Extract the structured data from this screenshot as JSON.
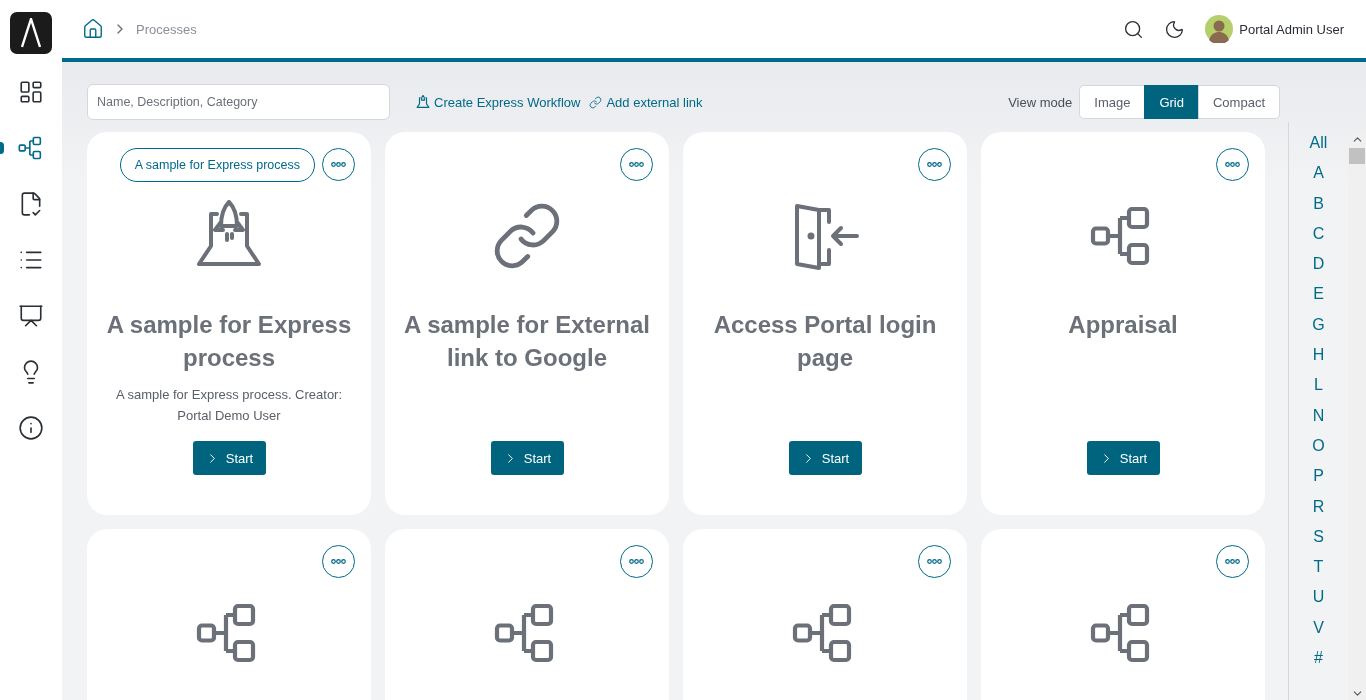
{
  "breadcrumb": {
    "current": "Processes"
  },
  "header": {
    "user": "Portal Admin User"
  },
  "sidebar": {
    "items": [
      {
        "kind": "dashboard",
        "selected": false
      },
      {
        "kind": "processes",
        "selected": true
      },
      {
        "kind": "tasks",
        "selected": false
      },
      {
        "kind": "cases",
        "selected": false
      },
      {
        "kind": "statistics",
        "selected": false
      },
      {
        "kind": "ideas",
        "selected": false
      },
      {
        "kind": "about",
        "selected": false
      }
    ]
  },
  "toolbar": {
    "search": {
      "placeholder": "Name, Description, Category"
    },
    "links": [
      {
        "kind": "express",
        "label": "Create Express Workflow"
      },
      {
        "kind": "external",
        "label": "Add external link"
      }
    ],
    "view_mode": {
      "label": "View mode",
      "options": [
        {
          "label": "Image",
          "selected": false
        },
        {
          "label": "Grid",
          "selected": true
        },
        {
          "label": "Compact",
          "selected": false
        }
      ]
    }
  },
  "cards": [
    {
      "kind": "express",
      "tag": "A sample for Express process",
      "title": "A sample for Express process",
      "description": "A sample for Express process. Creator: Portal Demo User",
      "button": "Start"
    },
    {
      "kind": "external",
      "title": "A sample for External link to Google",
      "button": "Start"
    },
    {
      "kind": "login",
      "title": "Access Portal login page",
      "button": "Start"
    },
    {
      "kind": "process",
      "title": "Appraisal",
      "button": "Start"
    },
    {
      "kind": "process"
    },
    {
      "kind": "process"
    },
    {
      "kind": "process"
    },
    {
      "kind": "process"
    }
  ],
  "alphabet": [
    "All",
    "A",
    "B",
    "C",
    "D",
    "E",
    "G",
    "H",
    "L",
    "N",
    "O",
    "P",
    "R",
    "S",
    "T",
    "U",
    "V",
    "#"
  ]
}
